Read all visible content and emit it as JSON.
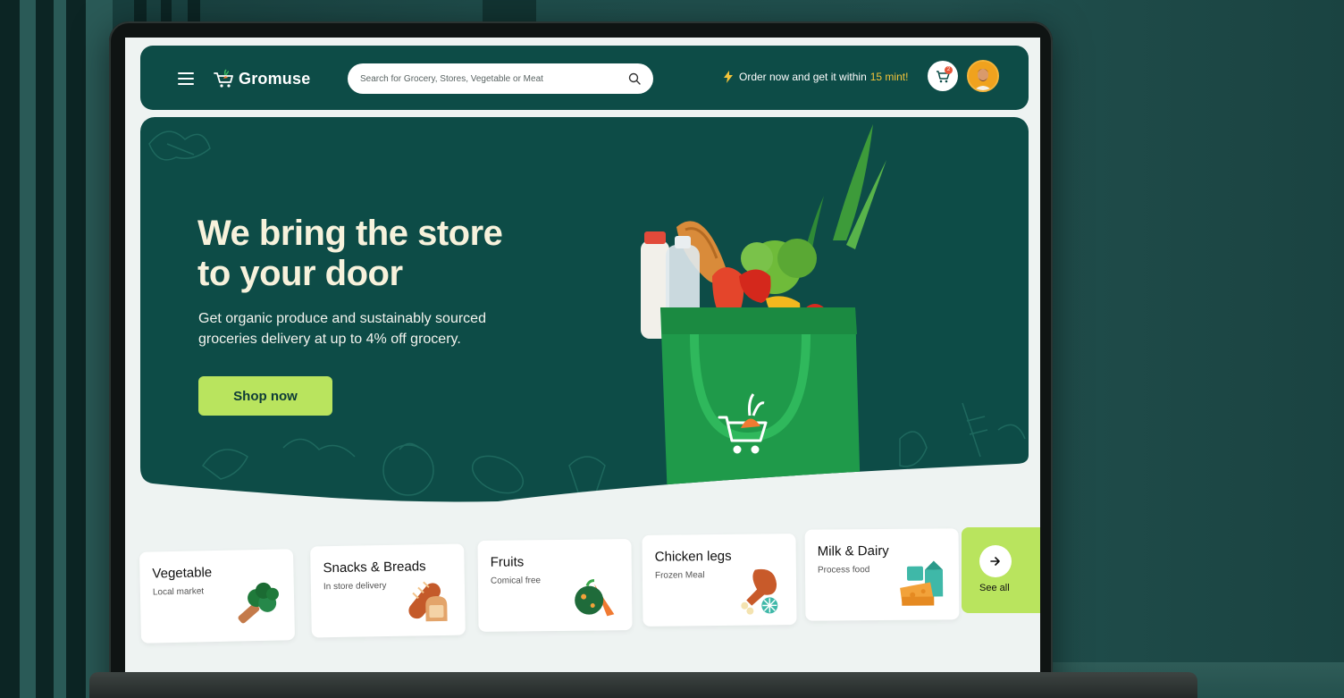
{
  "header": {
    "app_name": "Gromuse",
    "search_placeholder": "Search for Grocery, Stores, Vegetable or Meat",
    "promo_text": "Order now and get it within",
    "promo_highlight": "15 mint!",
    "cart_count": "2"
  },
  "hero": {
    "title_line1": "We bring the store",
    "title_line2": "to your door",
    "subtitle": "Get organic produce and sustainably sourced groceries delivery at up to 4% off grocery.",
    "cta_label": "Shop now"
  },
  "categories": [
    {
      "title": "Vegetable",
      "subtitle": "Local market",
      "icon": "broccoli-icon"
    },
    {
      "title": "Snacks & Breads",
      "subtitle": "In store delivery",
      "icon": "bread-icon"
    },
    {
      "title": "Fruits",
      "subtitle": "Comical free",
      "icon": "fruits-icon"
    },
    {
      "title": "Chicken legs",
      "subtitle": "Frozen Meal",
      "icon": "chicken-leg-icon"
    },
    {
      "title": "Milk & Dairy",
      "subtitle": "Process food",
      "icon": "dairy-icon"
    }
  ],
  "see_all_label": "See all",
  "colors": {
    "primary": "#0d4c47",
    "accent": "#b9e45e",
    "highlight": "#f2c33a",
    "title": "#f7f2dc"
  }
}
